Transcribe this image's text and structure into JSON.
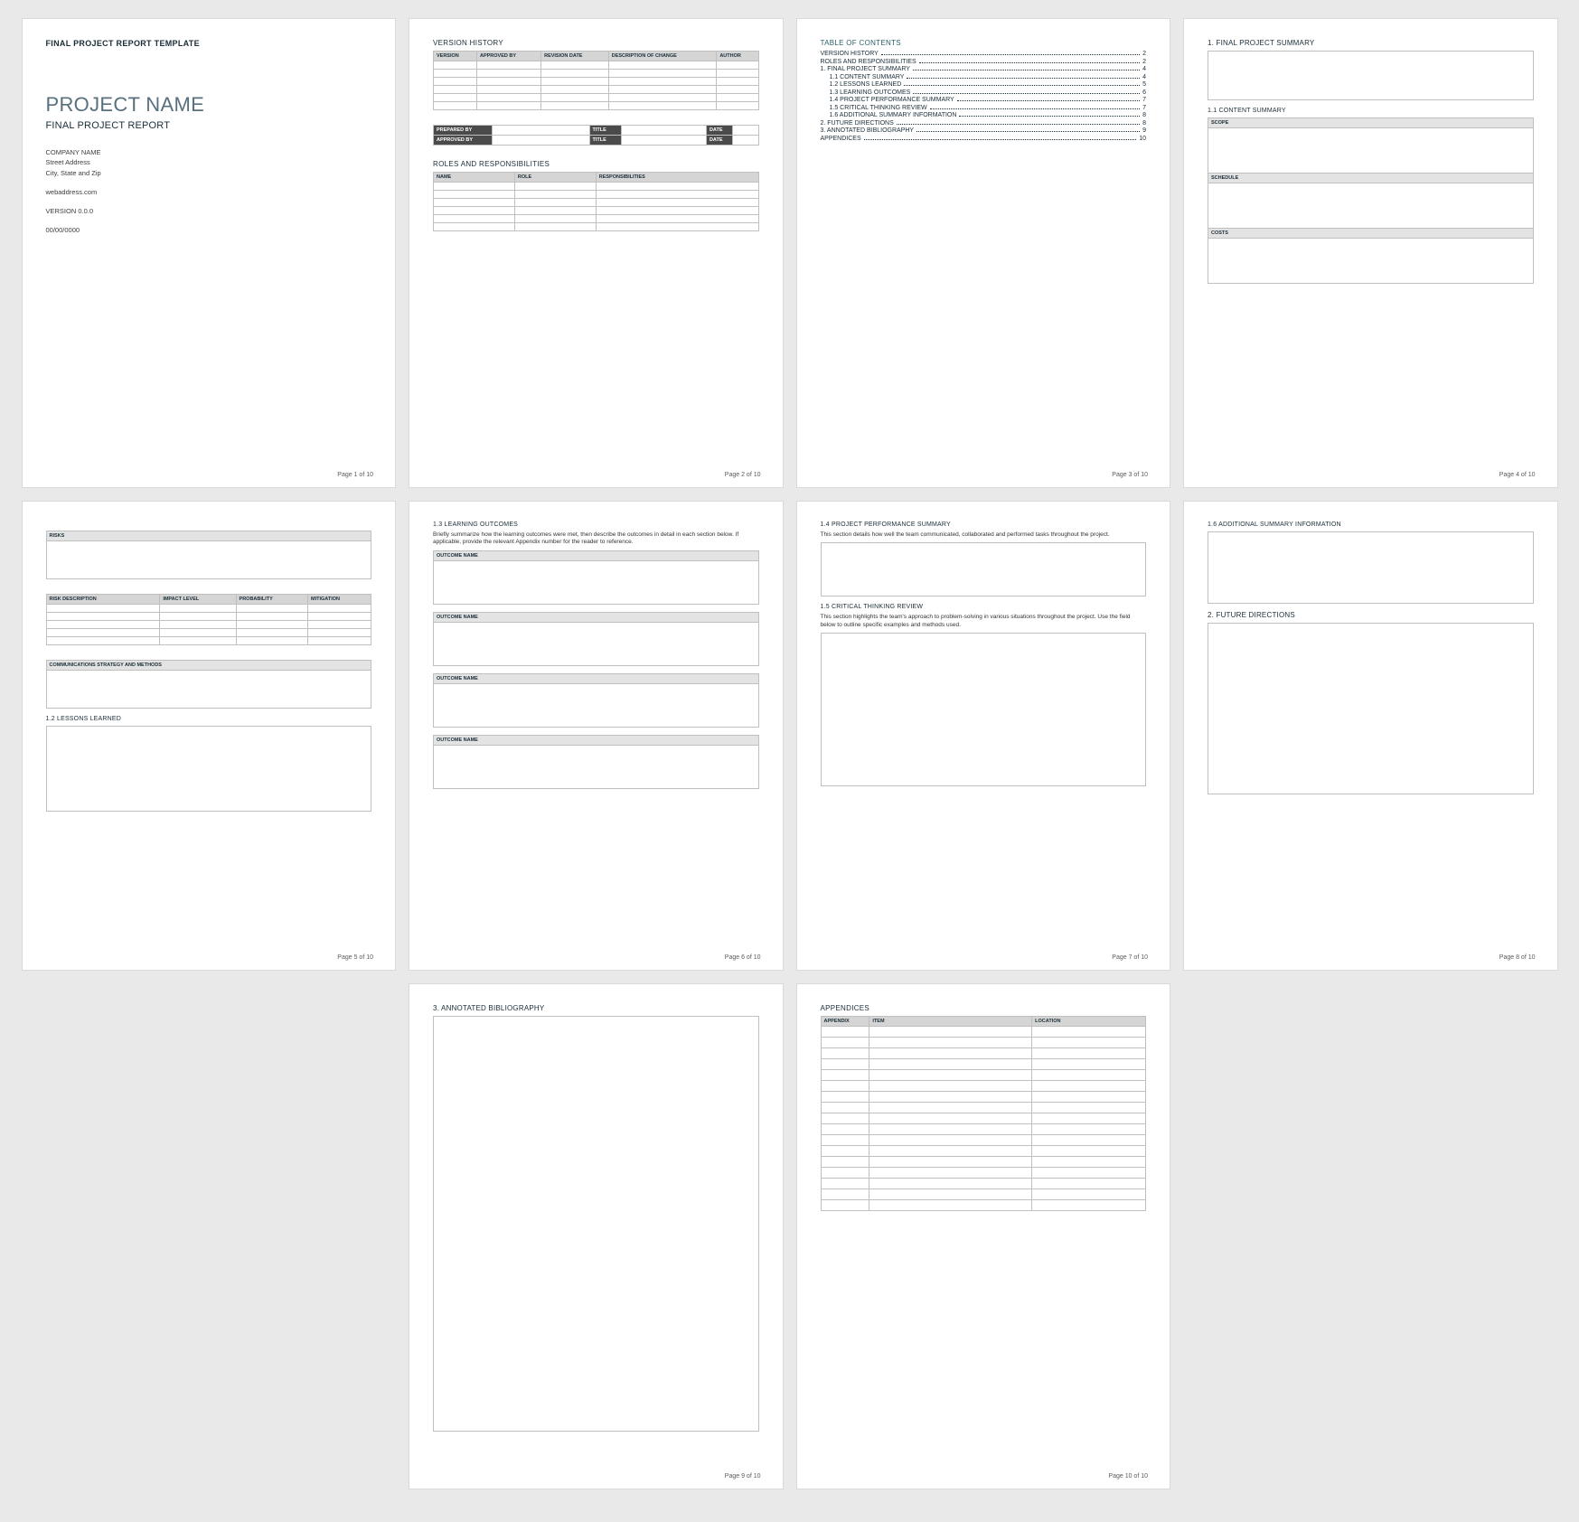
{
  "p1": {
    "small": "FINAL PROJECT REPORT TEMPLATE",
    "title": "PROJECT NAME",
    "sub": "FINAL PROJECT REPORT",
    "c1": "COMPANY NAME",
    "c2": "Street Address",
    "c3": "City, State and Zip",
    "web": "webaddress.com",
    "ver": "VERSION 0.0.0",
    "date": "00/00/0000",
    "foot": "Page 1 of 10"
  },
  "p2": {
    "h": "VERSION HISTORY",
    "vh": [
      "VERSION",
      "APPROVED BY",
      "REVISION DATE",
      "DESCRIPTION OF CHANGE",
      "AUTHOR"
    ],
    "sig": {
      "prep": "PREPARED BY",
      "appr": "APPROVED BY",
      "title": "TITLE",
      "date": "DATE"
    },
    "r": "ROLES AND RESPONSIBILITIES",
    "rh": [
      "NAME",
      "ROLE",
      "RESPONSIBILITIES"
    ],
    "foot": "Page 2 of 10"
  },
  "p3": {
    "h": "TABLE OF CONTENTS",
    "rows": [
      {
        "i": 0,
        "t": "VERSION HISTORY",
        "p": "2"
      },
      {
        "i": 0,
        "t": "ROLES AND RESPONSIBILITIES",
        "p": "2"
      },
      {
        "i": 0,
        "t": "1.   FINAL PROJECT SUMMARY",
        "p": "4"
      },
      {
        "i": 1,
        "t": "1.1   CONTENT SUMMARY",
        "p": "4"
      },
      {
        "i": 1,
        "t": "1.2   LESSONS LEARNED",
        "p": "5"
      },
      {
        "i": 1,
        "t": "1.3   LEARNING OUTCOMES",
        "p": "6"
      },
      {
        "i": 1,
        "t": "1.4   PROJECT PERFORMANCE SUMMARY",
        "p": "7"
      },
      {
        "i": 1,
        "t": "1.5   CRITICAL THINKING REVIEW",
        "p": "7"
      },
      {
        "i": 1,
        "t": "1.6   ADDITIONAL SUMMARY INFORMATION",
        "p": "8"
      },
      {
        "i": 0,
        "t": "2.   FUTURE DIRECTIONS",
        "p": "8"
      },
      {
        "i": 0,
        "t": "3.   ANNOTATED BIBLIOGRAPHY",
        "p": "9"
      },
      {
        "i": 0,
        "t": "APPENDICES",
        "p": "10"
      }
    ],
    "foot": "Page 3 of 10"
  },
  "p4": {
    "h": "1.   FINAL PROJECT SUMMARY",
    "sub": "1.1   CONTENT SUMMARY",
    "f1": "SCOPE",
    "f2": "SCHEDULE",
    "f3": "COSTS",
    "foot": "Page 4 of 10"
  },
  "p5": {
    "f1": "RISKS",
    "rh": [
      "RISK DESCRIPTION",
      "IMPACT LEVEL",
      "PROBABILITY",
      "MITIGATION"
    ],
    "f2": "COMMUNICATIONS STRATEGY AND METHODS",
    "h": "1.2   LESSONS LEARNED",
    "foot": "Page 5 of 10"
  },
  "p6": {
    "h": "1.3   LEARNING OUTCOMES",
    "d": "Briefly summarize how the learning outcomes were met, then describe the outcomes in detail in each section below. If applicable, provide the relevant Appendix number for the reader to reference.",
    "o": "OUTCOME NAME",
    "foot": "Page 6 of 10"
  },
  "p7": {
    "h1": "1.4   PROJECT PERFORMANCE SUMMARY",
    "d1": "This section details how well the team communicated, collaborated and performed tasks throughout the project.",
    "h2": "1.5   CRITICAL THINKING REVIEW",
    "d2": "This section highlights the team's approach to problem-solving in various situations throughout the project. Use the field below to outline specific examples and methods used.",
    "foot": "Page 7 of 10"
  },
  "p8": {
    "h1": "1.6   ADDITIONAL SUMMARY INFORMATION",
    "h2": "2.   FUTURE DIRECTIONS",
    "foot": "Page 8 of 10"
  },
  "p9": {
    "h": "3.   ANNOTATED BIBLIOGRAPHY",
    "foot": "Page 9 of 10"
  },
  "p10": {
    "h": "APPENDICES",
    "th": [
      "APPENDIX",
      "ITEM",
      "LOCATION"
    ],
    "foot": "Page 10 of 10"
  }
}
